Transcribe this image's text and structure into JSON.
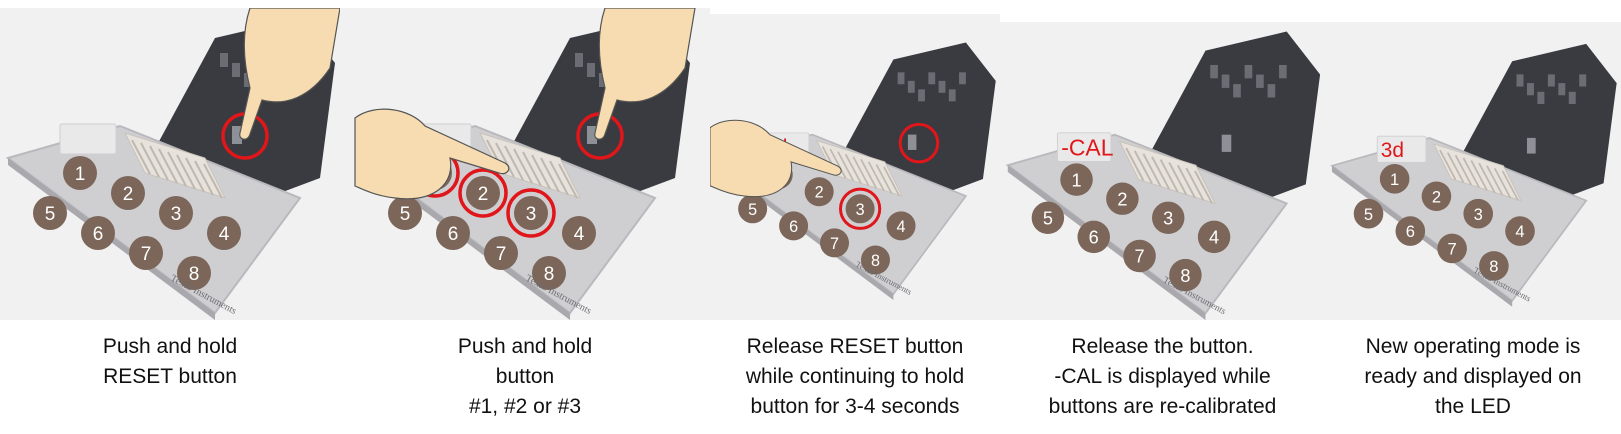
{
  "colors": {
    "pad": "#cfcfd2",
    "button": "#7b6659",
    "button_text": "#ffffff",
    "pcb": "#3a3b40",
    "connector": "#e7e2dc",
    "highlight_ring": "#e0161b",
    "led_text": "#e0161b",
    "hand": "#f6dcb0",
    "caption_text": "#111111"
  },
  "icons": {
    "pointing_hand": "pointing-hand-icon",
    "highlight_ring": "highlight-circle-icon",
    "ti_logo": "texas-instruments-logo"
  },
  "pad_buttons": [
    "1",
    "2",
    "3",
    "4",
    "5",
    "6",
    "7",
    "8"
  ],
  "brand": "Texas Instruments",
  "steps": [
    {
      "caption": [
        "Push and hold",
        "RESET button"
      ],
      "led": "",
      "rings": [
        "reset"
      ],
      "hands": [
        "top"
      ]
    },
    {
      "caption": [
        "Push and hold",
        "button",
        "#1, #2 or #3"
      ],
      "led": "",
      "rings": [
        "reset",
        "b1",
        "b2",
        "b3"
      ],
      "hands": [
        "top",
        "left"
      ]
    },
    {
      "caption": [
        "Release RESET button",
        "while continuing to hold",
        "button for 3-4 seconds"
      ],
      "led": "1d",
      "rings": [
        "reset",
        "b3"
      ],
      "hands": [
        "left"
      ]
    },
    {
      "caption": [
        "Release the button.",
        "-CAL is displayed while",
        "buttons are re-calibrated"
      ],
      "led": "-CAL",
      "rings": [],
      "hands": []
    },
    {
      "caption": [
        "New operating mode is",
        "ready and displayed on",
        "the LED"
      ],
      "led": "3d",
      "rings": [],
      "hands": []
    }
  ]
}
